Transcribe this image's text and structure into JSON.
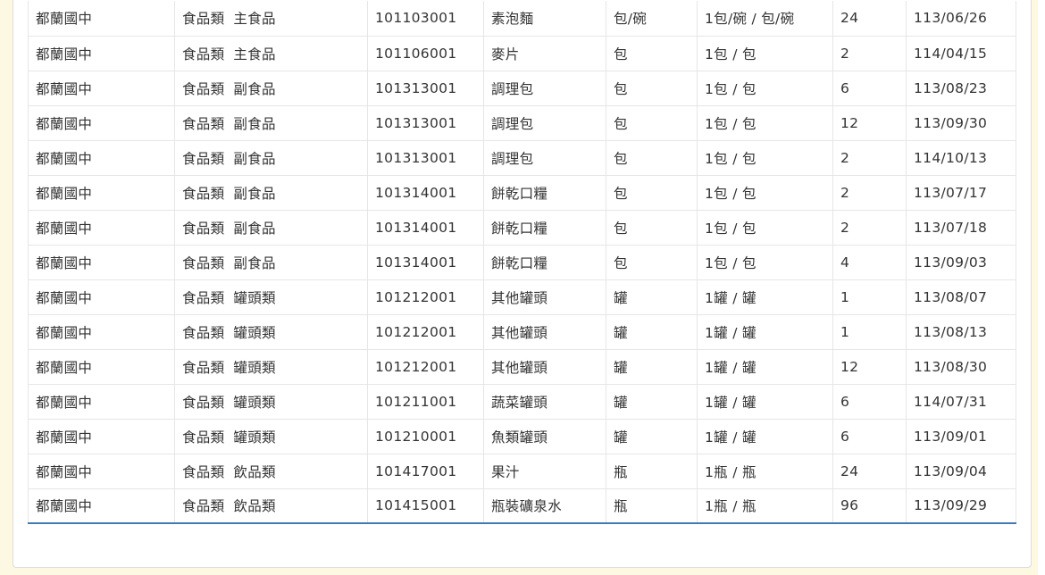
{
  "rows": [
    {
      "school": "都蘭國中",
      "cat1": "食品類",
      "cat2": "主食品",
      "code": "101103001",
      "item": "素泡麵",
      "unit": "包/碗",
      "spec": "1包/碗 / 包/碗",
      "qty": "24",
      "date": "113/06/26"
    },
    {
      "school": "都蘭國中",
      "cat1": "食品類",
      "cat2": "主食品",
      "code": "101106001",
      "item": "麥片",
      "unit": "包",
      "spec": "1包 / 包",
      "qty": "2",
      "date": "114/04/15"
    },
    {
      "school": "都蘭國中",
      "cat1": "食品類",
      "cat2": "副食品",
      "code": "101313001",
      "item": "調理包",
      "unit": "包",
      "spec": "1包 / 包",
      "qty": "6",
      "date": "113/08/23"
    },
    {
      "school": "都蘭國中",
      "cat1": "食品類",
      "cat2": "副食品",
      "code": "101313001",
      "item": "調理包",
      "unit": "包",
      "spec": "1包 / 包",
      "qty": "12",
      "date": "113/09/30"
    },
    {
      "school": "都蘭國中",
      "cat1": "食品類",
      "cat2": "副食品",
      "code": "101313001",
      "item": "調理包",
      "unit": "包",
      "spec": "1包 / 包",
      "qty": "2",
      "date": "114/10/13"
    },
    {
      "school": "都蘭國中",
      "cat1": "食品類",
      "cat2": "副食品",
      "code": "101314001",
      "item": "餅乾口糧",
      "unit": "包",
      "spec": "1包 / 包",
      "qty": "2",
      "date": "113/07/17"
    },
    {
      "school": "都蘭國中",
      "cat1": "食品類",
      "cat2": "副食品",
      "code": "101314001",
      "item": "餅乾口糧",
      "unit": "包",
      "spec": "1包 / 包",
      "qty": "2",
      "date": "113/07/18"
    },
    {
      "school": "都蘭國中",
      "cat1": "食品類",
      "cat2": "副食品",
      "code": "101314001",
      "item": "餅乾口糧",
      "unit": "包",
      "spec": "1包 / 包",
      "qty": "4",
      "date": "113/09/03"
    },
    {
      "school": "都蘭國中",
      "cat1": "食品類",
      "cat2": "罐頭類",
      "code": "101212001",
      "item": "其他罐頭",
      "unit": "罐",
      "spec": "1罐 / 罐",
      "qty": "1",
      "date": "113/08/07"
    },
    {
      "school": "都蘭國中",
      "cat1": "食品類",
      "cat2": "罐頭類",
      "code": "101212001",
      "item": "其他罐頭",
      "unit": "罐",
      "spec": "1罐 / 罐",
      "qty": "1",
      "date": "113/08/13"
    },
    {
      "school": "都蘭國中",
      "cat1": "食品類",
      "cat2": "罐頭類",
      "code": "101212001",
      "item": "其他罐頭",
      "unit": "罐",
      "spec": "1罐 / 罐",
      "qty": "12",
      "date": "113/08/30"
    },
    {
      "school": "都蘭國中",
      "cat1": "食品類",
      "cat2": "罐頭類",
      "code": "101211001",
      "item": "蔬菜罐頭",
      "unit": "罐",
      "spec": "1罐 / 罐",
      "qty": "6",
      "date": "114/07/31"
    },
    {
      "school": "都蘭國中",
      "cat1": "食品類",
      "cat2": "罐頭類",
      "code": "101210001",
      "item": "魚類罐頭",
      "unit": "罐",
      "spec": "1罐 / 罐",
      "qty": "6",
      "date": "113/09/01"
    },
    {
      "school": "都蘭國中",
      "cat1": "食品類",
      "cat2": "飲品類",
      "code": "101417001",
      "item": "果汁",
      "unit": "瓶",
      "spec": "1瓶 / 瓶",
      "qty": "24",
      "date": "113/09/04"
    },
    {
      "school": "都蘭國中",
      "cat1": "食品類",
      "cat2": "飲品類",
      "code": "101415001",
      "item": "瓶裝礦泉水",
      "unit": "瓶",
      "spec": "1瓶 / 瓶",
      "qty": "96",
      "date": "113/09/29"
    }
  ],
  "colors": {
    "background": "#fdf8e1",
    "panel": "#ffffff",
    "grid_line": "#e6e6e6",
    "table_bottom_accent": "#3a7cbf",
    "text": "#333333"
  }
}
